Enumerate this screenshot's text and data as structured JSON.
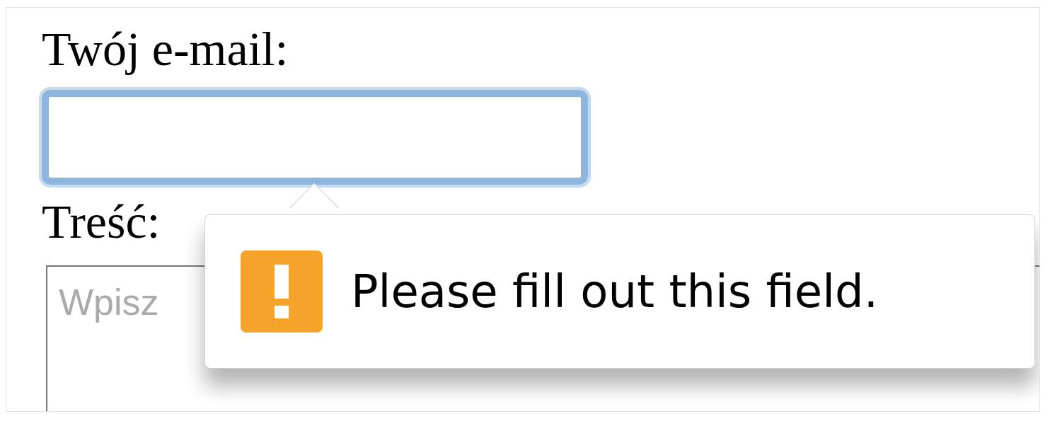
{
  "email": {
    "label": "Twój e-mail:",
    "focused": true
  },
  "message": {
    "label": "Treść:",
    "placeholder": "Wpisz"
  },
  "validation_tooltip": {
    "text": "Please fill out this field."
  }
}
